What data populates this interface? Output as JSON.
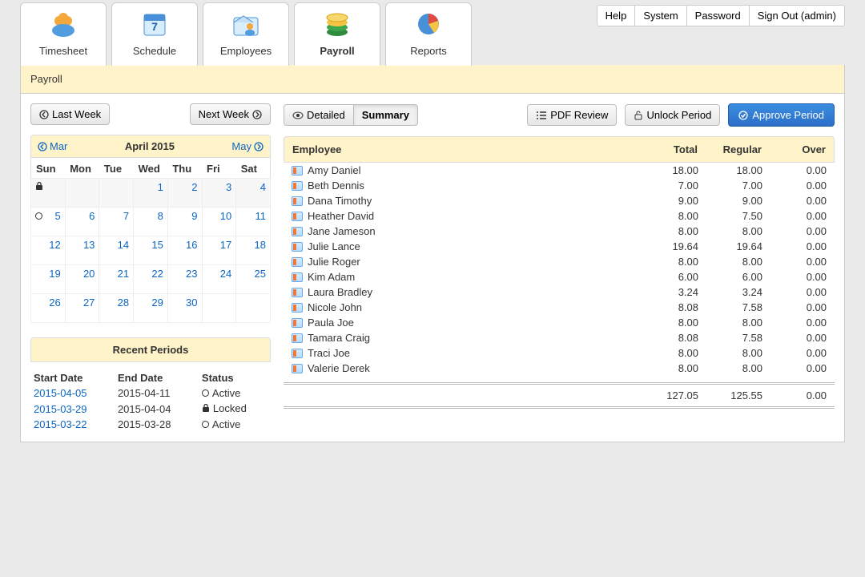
{
  "topmenu": [
    {
      "label": "Help"
    },
    {
      "label": "System"
    },
    {
      "label": "Password"
    },
    {
      "label": "Sign Out (admin)"
    }
  ],
  "tabs": [
    {
      "id": "timesheet",
      "label": "Timesheet"
    },
    {
      "id": "schedule",
      "label": "Schedule"
    },
    {
      "id": "employees",
      "label": "Employees"
    },
    {
      "id": "payroll",
      "label": "Payroll"
    },
    {
      "id": "reports",
      "label": "Reports"
    }
  ],
  "active_tab": "payroll",
  "page_title": "Payroll",
  "week_nav": {
    "prev": "Last Week",
    "next": "Next Week"
  },
  "view_toggle": {
    "detailed": "Detailed",
    "summary": "Summary",
    "active": "summary"
  },
  "action_buttons": {
    "pdf": "PDF Review",
    "unlock": "Unlock Period",
    "approve": "Approve Period"
  },
  "calendar": {
    "prev_label": "Mar",
    "next_label": "May",
    "title": "April 2015",
    "weekdays": [
      "Sun",
      "Mon",
      "Tue",
      "Wed",
      "Thu",
      "Fri",
      "Sat"
    ],
    "weeks": [
      [
        {
          "d": "",
          "other": true,
          "marker": "lock"
        },
        {
          "d": "",
          "other": true
        },
        {
          "d": "",
          "other": true
        },
        {
          "d": "1",
          "other": true
        },
        {
          "d": "2",
          "other": true
        },
        {
          "d": "3",
          "other": true
        },
        {
          "d": "4",
          "other": true
        }
      ],
      [
        {
          "d": "5",
          "marker": "active"
        },
        {
          "d": "6"
        },
        {
          "d": "7"
        },
        {
          "d": "8"
        },
        {
          "d": "9"
        },
        {
          "d": "10"
        },
        {
          "d": "11"
        }
      ],
      [
        {
          "d": "12"
        },
        {
          "d": "13"
        },
        {
          "d": "14"
        },
        {
          "d": "15"
        },
        {
          "d": "16"
        },
        {
          "d": "17"
        },
        {
          "d": "18"
        }
      ],
      [
        {
          "d": "19"
        },
        {
          "d": "20"
        },
        {
          "d": "21"
        },
        {
          "d": "22"
        },
        {
          "d": "23"
        },
        {
          "d": "24"
        },
        {
          "d": "25"
        }
      ],
      [
        {
          "d": "26"
        },
        {
          "d": "27"
        },
        {
          "d": "28"
        },
        {
          "d": "29"
        },
        {
          "d": "30"
        },
        {
          "d": ""
        },
        {
          "d": ""
        }
      ]
    ]
  },
  "recent_periods": {
    "title": "Recent Periods",
    "headers": {
      "start": "Start Date",
      "end": "End Date",
      "status": "Status"
    },
    "rows": [
      {
        "start": "2015-04-05",
        "end": "2015-04-11",
        "status": "Active",
        "icon": "active"
      },
      {
        "start": "2015-03-29",
        "end": "2015-04-04",
        "status": "Locked",
        "icon": "lock"
      },
      {
        "start": "2015-03-22",
        "end": "2015-03-28",
        "status": "Active",
        "icon": "active"
      }
    ]
  },
  "employee_table": {
    "headers": {
      "name": "Employee",
      "total": "Total",
      "regular": "Regular",
      "over": "Over"
    },
    "rows": [
      {
        "name": "Amy Daniel",
        "total": "18.00",
        "regular": "18.00",
        "over": "0.00"
      },
      {
        "name": "Beth Dennis",
        "total": "7.00",
        "regular": "7.00",
        "over": "0.00"
      },
      {
        "name": "Dana Timothy",
        "total": "9.00",
        "regular": "9.00",
        "over": "0.00"
      },
      {
        "name": "Heather David",
        "total": "8.00",
        "regular": "7.50",
        "over": "0.00"
      },
      {
        "name": "Jane Jameson",
        "total": "8.00",
        "regular": "8.00",
        "over": "0.00"
      },
      {
        "name": "Julie Lance",
        "total": "19.64",
        "regular": "19.64",
        "over": "0.00"
      },
      {
        "name": "Julie Roger",
        "total": "8.00",
        "regular": "8.00",
        "over": "0.00"
      },
      {
        "name": "Kim Adam",
        "total": "6.00",
        "regular": "6.00",
        "over": "0.00"
      },
      {
        "name": "Laura Bradley",
        "total": "3.24",
        "regular": "3.24",
        "over": "0.00"
      },
      {
        "name": "Nicole John",
        "total": "8.08",
        "regular": "7.58",
        "over": "0.00"
      },
      {
        "name": "Paula Joe",
        "total": "8.00",
        "regular": "8.00",
        "over": "0.00"
      },
      {
        "name": "Tamara Craig",
        "total": "8.08",
        "regular": "7.58",
        "over": "0.00"
      },
      {
        "name": "Traci Joe",
        "total": "8.00",
        "regular": "8.00",
        "over": "0.00"
      },
      {
        "name": "Valerie Derek",
        "total": "8.00",
        "regular": "8.00",
        "over": "0.00"
      }
    ],
    "totals": {
      "total": "127.05",
      "regular": "125.55",
      "over": "0.00"
    }
  }
}
